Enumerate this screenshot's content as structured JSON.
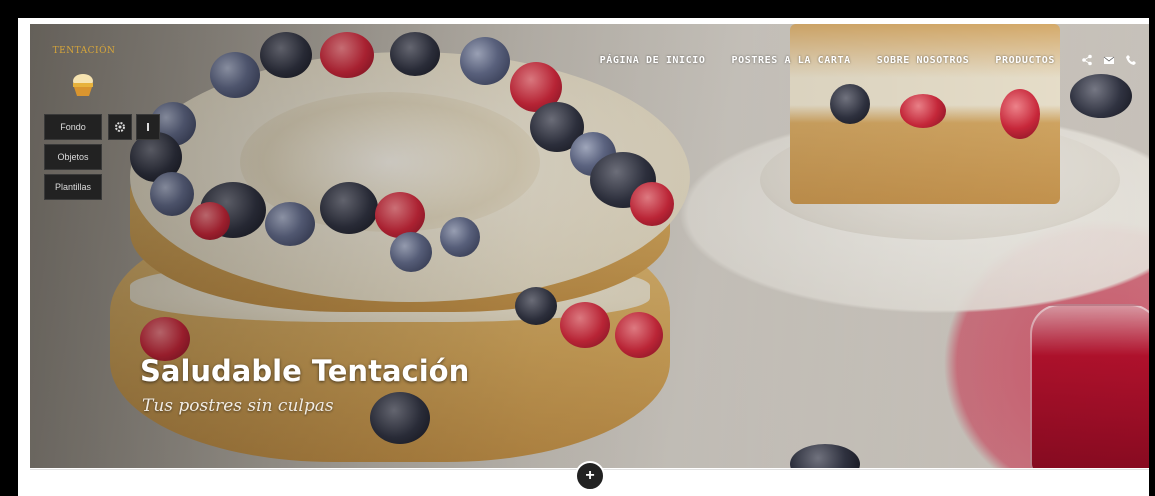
{
  "logo": {
    "top_text": "",
    "brand_name": "TENTACIÓN",
    "icon": "cupcake-icon"
  },
  "nav": {
    "items": [
      {
        "label": "PÁGINA DE INICIO"
      },
      {
        "label": "POSTRES A LA CARTA"
      },
      {
        "label": "SOBRE NOSOTROS"
      },
      {
        "label": "PRODUCTOS"
      }
    ],
    "icons": [
      "share-icon",
      "mail-icon",
      "phone-icon"
    ]
  },
  "tools": {
    "fondo": "Fondo",
    "settings_icon": "gear-icon",
    "info_icon": "info-icon",
    "objetos": "Objetos",
    "plantillas": "Plantillas"
  },
  "hero": {
    "title": "Saludable Tentación",
    "subtitle": "Tus postres sin culpas"
  },
  "add_button": {
    "label": "+",
    "icon": "plus-icon"
  },
  "colors": {
    "accent": "#e7b23c",
    "dark": "#222222",
    "berry_red": "#d62a3e"
  }
}
